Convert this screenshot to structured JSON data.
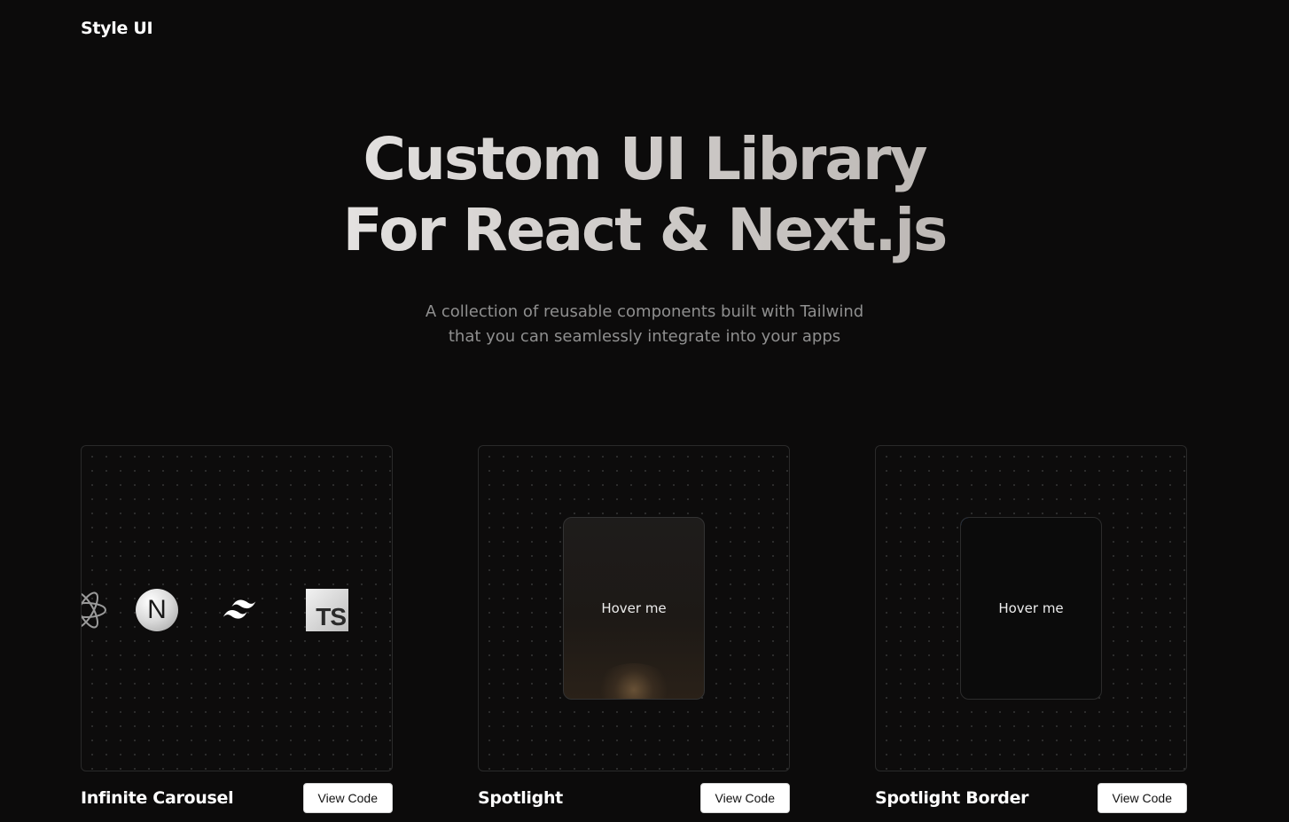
{
  "header": {
    "brand": "Style UI"
  },
  "hero": {
    "title_line1": "Custom UI Library",
    "title_line2": "For React & Next.js",
    "subtitle_line1": "A collection of reusable components built with Tailwind",
    "subtitle_line2": "that you can seamlessly integrate into your apps"
  },
  "cards": [
    {
      "title": "Infinite Carousel",
      "button": "View Code",
      "logos": [
        "react-icon",
        "nextjs-icon",
        "tailwind-icon",
        "typescript-icon"
      ],
      "next_letter": "N",
      "ts_text": "TS"
    },
    {
      "title": "Spotlight",
      "button": "View Code",
      "hover_text": "Hover me"
    },
    {
      "title": "Spotlight Border",
      "button": "View Code",
      "hover_text": "Hover me",
      "glow_color": "#3b82f6"
    }
  ],
  "colors": {
    "background": "#0c0b0b",
    "subtitle": "#8f8f8f",
    "button_bg": "#ffffff"
  }
}
